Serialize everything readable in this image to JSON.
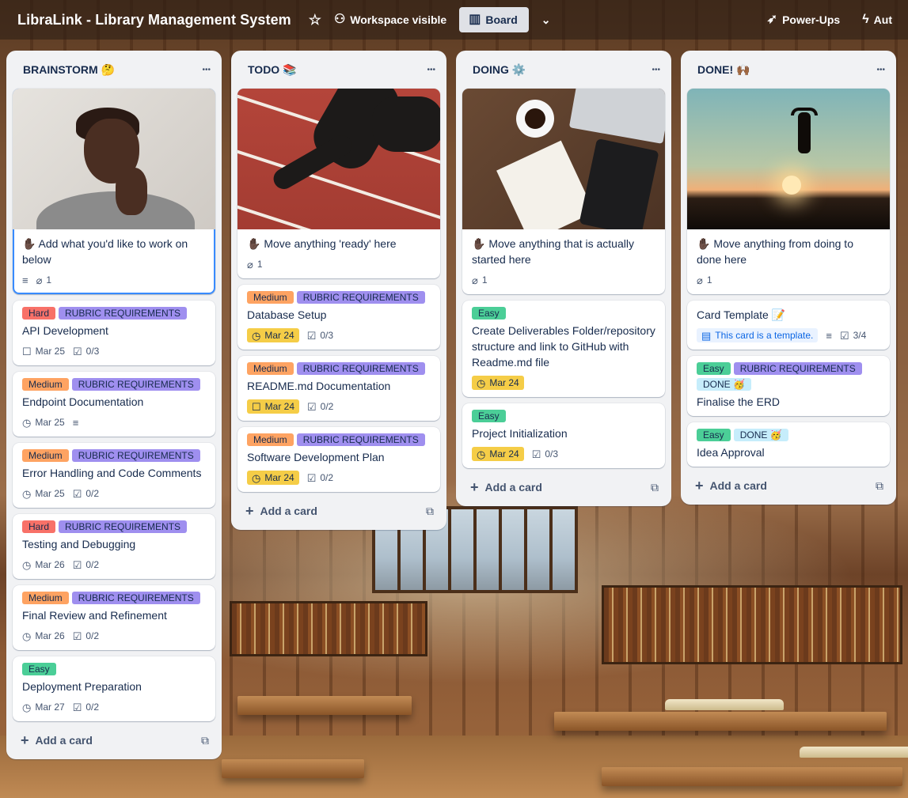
{
  "board": {
    "title": "LibraLink - Library Management System",
    "visibility_label": "Workspace visible",
    "view_label": "Board",
    "powerups_label": "Power-Ups",
    "automation_label": "Aut"
  },
  "lists": [
    {
      "title": "BRAINSTORM",
      "emoji": "🤔",
      "add_card_label": "Add a card",
      "cards": [
        {
          "cover": "woman",
          "title": "✋🏿 Add what you'd like to work on below",
          "has_description": true,
          "attachments": "1",
          "labels": [],
          "selected": true
        },
        {
          "labels": [
            {
              "text": "Hard",
              "kind": "hard"
            },
            {
              "text": "RUBRIC REQUIREMENTS",
              "kind": "rubric"
            }
          ],
          "title": "API Development",
          "date": "Mar 25",
          "checklist": "0/3"
        },
        {
          "labels": [
            {
              "text": "Medium",
              "kind": "medium"
            },
            {
              "text": "RUBRIC REQUIREMENTS",
              "kind": "rubric"
            }
          ],
          "title": "Endpoint Documentation",
          "date": "Mar 25",
          "has_description": true
        },
        {
          "labels": [
            {
              "text": "Medium",
              "kind": "medium"
            },
            {
              "text": "RUBRIC REQUIREMENTS",
              "kind": "rubric"
            }
          ],
          "title": "Error Handling and Code Comments",
          "date": "Mar 25",
          "checklist": "0/2"
        },
        {
          "labels": [
            {
              "text": "Hard",
              "kind": "hard"
            },
            {
              "text": "RUBRIC REQUIREMENTS",
              "kind": "rubric"
            }
          ],
          "title": "Testing and Debugging",
          "date": "Mar 26",
          "checklist": "0/2"
        },
        {
          "labels": [
            {
              "text": "Medium",
              "kind": "medium"
            },
            {
              "text": "RUBRIC REQUIREMENTS",
              "kind": "rubric"
            }
          ],
          "title": "Final Review and Refinement",
          "date": "Mar 26",
          "checklist": "0/2"
        },
        {
          "labels": [
            {
              "text": "Easy",
              "kind": "easy"
            }
          ],
          "title": "Deployment Preparation",
          "date": "Mar 27",
          "checklist": "0/2"
        }
      ]
    },
    {
      "title": "TODO",
      "emoji": "📚",
      "add_card_label": "Add a card",
      "cards": [
        {
          "cover": "track",
          "title": "✋🏿 Move anything 'ready' here",
          "attachments": "1",
          "labels": []
        },
        {
          "labels": [
            {
              "text": "Medium",
              "kind": "medium"
            },
            {
              "text": "RUBRIC REQUIREMENTS",
              "kind": "rubric"
            }
          ],
          "title": "Database Setup",
          "date": "Mar 24",
          "date_style": "due",
          "checklist": "0/3"
        },
        {
          "labels": [
            {
              "text": "Medium",
              "kind": "medium"
            },
            {
              "text": "RUBRIC REQUIREMENTS",
              "kind": "rubric"
            }
          ],
          "title": "README.md Documentation",
          "date": "Mar 24",
          "date_style": "due-box",
          "checklist": "0/2"
        },
        {
          "labels": [
            {
              "text": "Medium",
              "kind": "medium"
            },
            {
              "text": "RUBRIC REQUIREMENTS",
              "kind": "rubric"
            }
          ],
          "title": "Software Development Plan",
          "date": "Mar 24",
          "date_style": "due",
          "checklist": "0/2"
        }
      ]
    },
    {
      "title": "DOING",
      "emoji": "⚙️",
      "add_card_label": "Add a card",
      "cards": [
        {
          "cover": "desk",
          "title": "✋🏿 Move anything that is actually started here",
          "attachments": "1",
          "labels": []
        },
        {
          "labels": [
            {
              "text": "Easy",
              "kind": "easy"
            }
          ],
          "title": "Create Deliverables Folder/repository structure and link to GitHub with Readme.md file",
          "date": "Mar 24",
          "date_style": "due"
        },
        {
          "labels": [
            {
              "text": "Easy",
              "kind": "easy"
            }
          ],
          "title": "Project Initialization",
          "date": "Mar 24",
          "date_style": "due",
          "checklist": "0/3"
        }
      ]
    },
    {
      "title": "DONE!",
      "emoji": "🙌🏾",
      "add_card_label": "Add a card",
      "cards": [
        {
          "cover": "sunset",
          "title": "✋🏿 Move anything from doing to done here",
          "attachments": "1",
          "labels": []
        },
        {
          "labels": [],
          "title": "Card Template 📝",
          "template_label": "This card is a template.",
          "has_description": true,
          "checklist": "3/4"
        },
        {
          "labels": [
            {
              "text": "Easy",
              "kind": "easy"
            },
            {
              "text": "RUBRIC REQUIREMENTS",
              "kind": "rubric"
            },
            {
              "text": "DONE 🥳",
              "kind": "done"
            }
          ],
          "title": "Finalise the ERD"
        },
        {
          "labels": [
            {
              "text": "Easy",
              "kind": "easy"
            },
            {
              "text": "DONE 🥳",
              "kind": "done"
            }
          ],
          "title": "Idea Approval"
        }
      ]
    }
  ],
  "colors": {
    "label_hard": "#f87168",
    "label_medium": "#fea362",
    "label_easy": "#4bce97",
    "label_rubric": "#9f8fef",
    "label_done": "#c6edfb",
    "due_badge": "#f5cd47",
    "list_bg": "#f1f2f4"
  },
  "icons": [
    "star-icon",
    "people-icon",
    "board-icon",
    "chevron-down-icon",
    "rocket-icon",
    "bolt-icon",
    "more-icon",
    "description-icon",
    "attachment-icon",
    "clock-icon",
    "checklist-icon",
    "plus-icon",
    "template-icon",
    "card-from-template-icon"
  ]
}
